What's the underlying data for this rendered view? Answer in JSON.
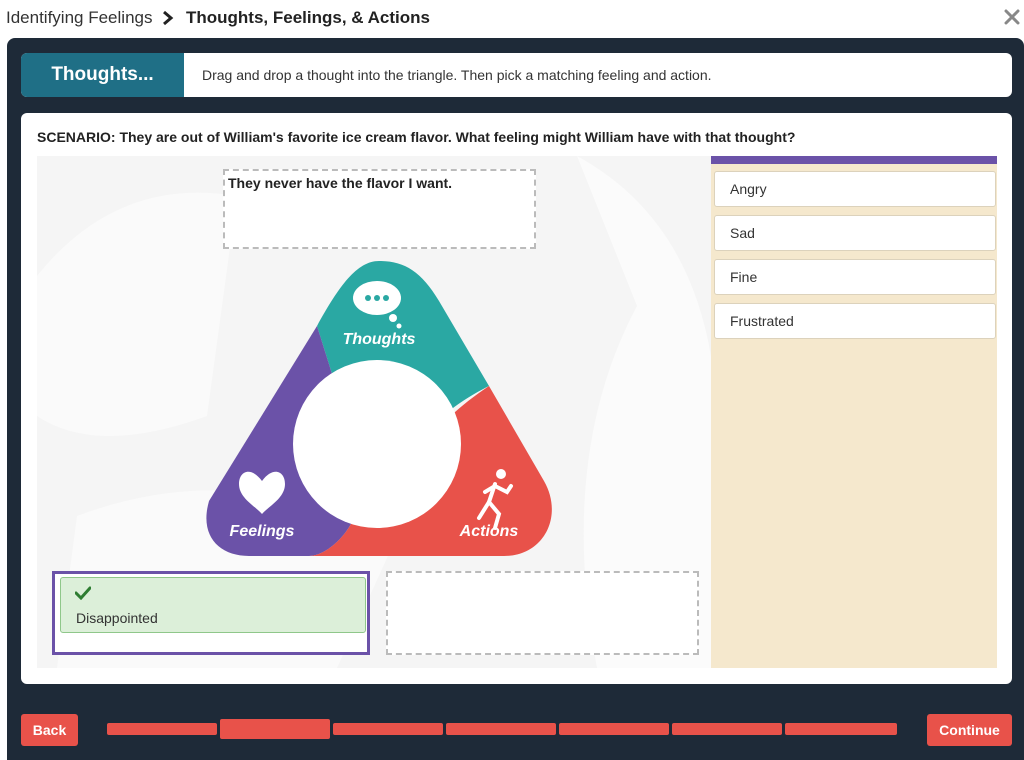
{
  "breadcrumb": {
    "root": "Identifying Feelings",
    "current": "Thoughts, Feelings, & Actions"
  },
  "header": {
    "tab_label": "Thoughts...",
    "instruction": "Drag and drop a thought into the triangle. Then pick a matching feeling and action."
  },
  "scenario": {
    "text": "SCENARIO: They are out of William's favorite ice cream flavor. What feeling might William have with that thought?"
  },
  "triangle": {
    "thoughts_label": "Thoughts",
    "feelings_label": "Feelings",
    "actions_label": "Actions",
    "colors": {
      "thoughts": "#2aa8a3",
      "feelings": "#6b52a8",
      "actions": "#e8524a"
    }
  },
  "drops": {
    "thought_value": "They never have the flavor I want.",
    "feeling_value": "Disappointed",
    "action_value": ""
  },
  "options": [
    "Angry",
    "Sad",
    "Fine",
    "Frustrated"
  ],
  "nav": {
    "back_label": "Back",
    "continue_label": "Continue",
    "progress": {
      "total": 7,
      "current": 2
    }
  },
  "icons": {
    "close": "close-icon",
    "chevron": "chevron-right-icon",
    "check": "check-icon",
    "thought": "thought-bubble-icon",
    "heart": "heart-icon",
    "runner": "running-person-icon"
  }
}
